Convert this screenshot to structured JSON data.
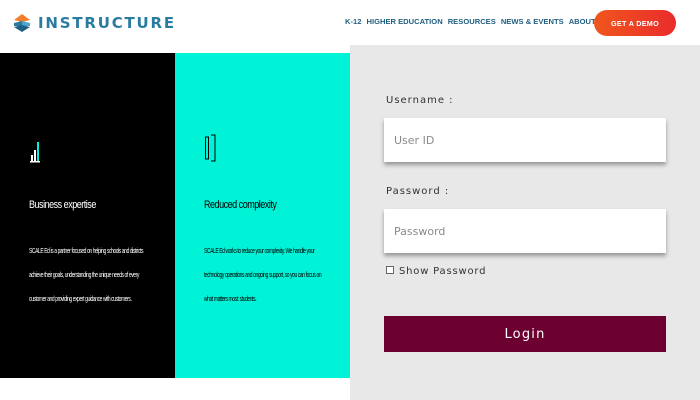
{
  "brand": {
    "name": "INSTRUCTURE",
    "logo_icon": "instructure-logo-icon"
  },
  "nav": {
    "items": [
      {
        "label": "K-12"
      },
      {
        "label": "HIGHER EDUCATION"
      },
      {
        "label": "RESOURCES"
      },
      {
        "label": "NEWS & EVENTS"
      },
      {
        "label": "ABOUT US"
      }
    ],
    "demo_button": "GET A DEMO"
  },
  "features": [
    {
      "icon": "bar-chart-icon",
      "title": "Business expertise",
      "text": "SCALE Ed is a partner focused on helping schools and districts achieve their goals, understanding the unique needs of every customer and providing expert guidance with customers."
    },
    {
      "icon": "bracket-icon",
      "title": "Reduced complexity",
      "text": "SCALE Ed works to reduce your complexity. We handle your technology operations and ongoing support, so you can focus on what matters most: students."
    }
  ],
  "login": {
    "username_label": "Username :",
    "username_placeholder": "User ID",
    "password_label": "Password :",
    "password_placeholder": "Password",
    "show_password_label": "Show Password",
    "login_button": "Login"
  },
  "colors": {
    "brand_blue": "#2a7ba0",
    "nav_blue": "#1f5f82",
    "demo_orange": "#f0561d",
    "panel_black": "#000000",
    "panel_teal": "#00f2d7",
    "login_bg": "#e8e8e8",
    "login_button": "#6c0030"
  }
}
